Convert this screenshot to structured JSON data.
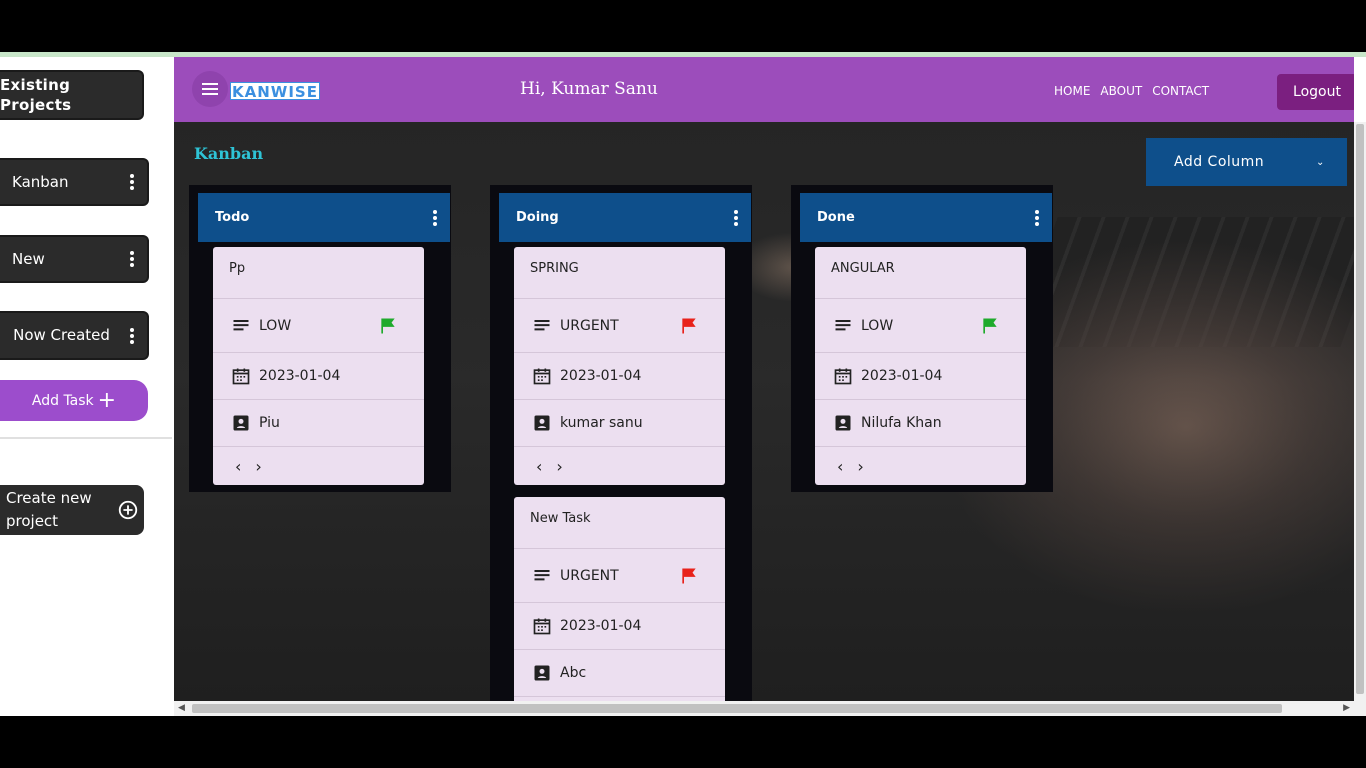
{
  "sidebar": {
    "existing_projects": "Existing Projects",
    "projects": [
      {
        "label": "Kanban"
      },
      {
        "label": "New"
      },
      {
        "label": "Now Created"
      }
    ],
    "add_task": "Add Task",
    "create_project": "Create new project"
  },
  "header": {
    "logo": "KANWISE",
    "greeting": "Hi, Kumar Sanu",
    "nav": [
      "HOME",
      "ABOUT",
      "CONTACT"
    ],
    "logout": "Logout",
    "color": "#9c4dbb"
  },
  "board": {
    "title": "Kanban",
    "add_column": "Add Column",
    "columns": [
      {
        "name": "Todo",
        "cards": [
          {
            "title": "Pp",
            "priority": "LOW",
            "flag_color": "#1faa2c",
            "date": "2023-01-04",
            "assignee": "Piu"
          }
        ]
      },
      {
        "name": "Doing",
        "cards": [
          {
            "title": "SPRING",
            "priority": "URGENT",
            "flag_color": "#e8221b",
            "date": "2023-01-04",
            "assignee": "kumar sanu"
          },
          {
            "title": "New Task",
            "priority": "URGENT",
            "flag_color": "#e8221b",
            "date": "2023-01-04",
            "assignee": "Abc"
          }
        ]
      },
      {
        "name": "Done",
        "cards": [
          {
            "title": "ANGULAR",
            "priority": "LOW",
            "flag_color": "#1faa2c",
            "date": "2023-01-04",
            "assignee": "Nilufa Khan"
          }
        ]
      }
    ]
  },
  "icons": {
    "menu": "menu-icon",
    "kebab": "more-vert-icon",
    "priority": "notes-icon",
    "date": "calendar-icon",
    "assignee": "contact-icon",
    "flag": "flag-icon",
    "prev": "chevron-left-icon",
    "next": "chevron-right-icon",
    "add_circle": "add-circle-icon"
  }
}
